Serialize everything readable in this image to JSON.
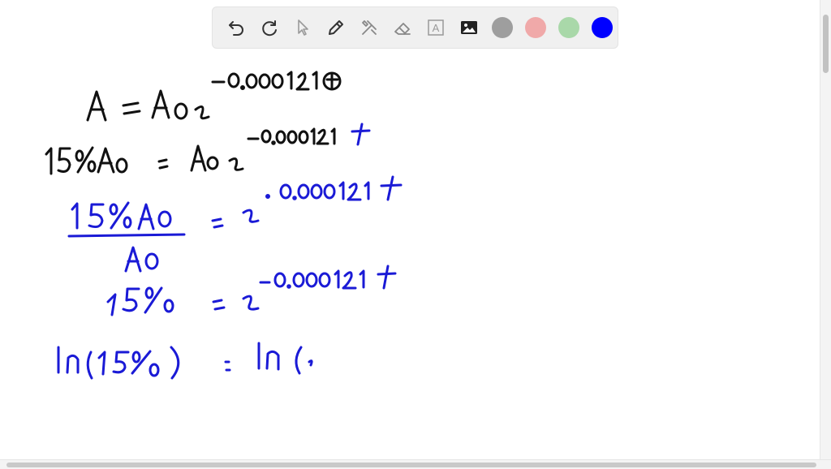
{
  "toolbar": {
    "tools": [
      {
        "name": "undo",
        "icon": "undo-icon"
      },
      {
        "name": "redo",
        "icon": "redo-icon"
      },
      {
        "name": "select",
        "icon": "cursor-icon"
      },
      {
        "name": "pen",
        "icon": "pencil-icon"
      },
      {
        "name": "shapes",
        "icon": "tools-icon"
      },
      {
        "name": "eraser",
        "icon": "eraser-icon"
      },
      {
        "name": "text",
        "icon": "text-icon",
        "glyph": "A"
      },
      {
        "name": "image",
        "icon": "image-icon"
      }
    ],
    "colors": [
      {
        "name": "gray",
        "hex": "#9e9e9e"
      },
      {
        "name": "pink",
        "hex": "#f0a9a9"
      },
      {
        "name": "green",
        "hex": "#a9d8a9"
      },
      {
        "name": "blue",
        "hex": "#0000ff",
        "selected": true
      }
    ]
  },
  "ink_colors": {
    "black": "#111111",
    "blue": "#1a1ad6"
  }
}
